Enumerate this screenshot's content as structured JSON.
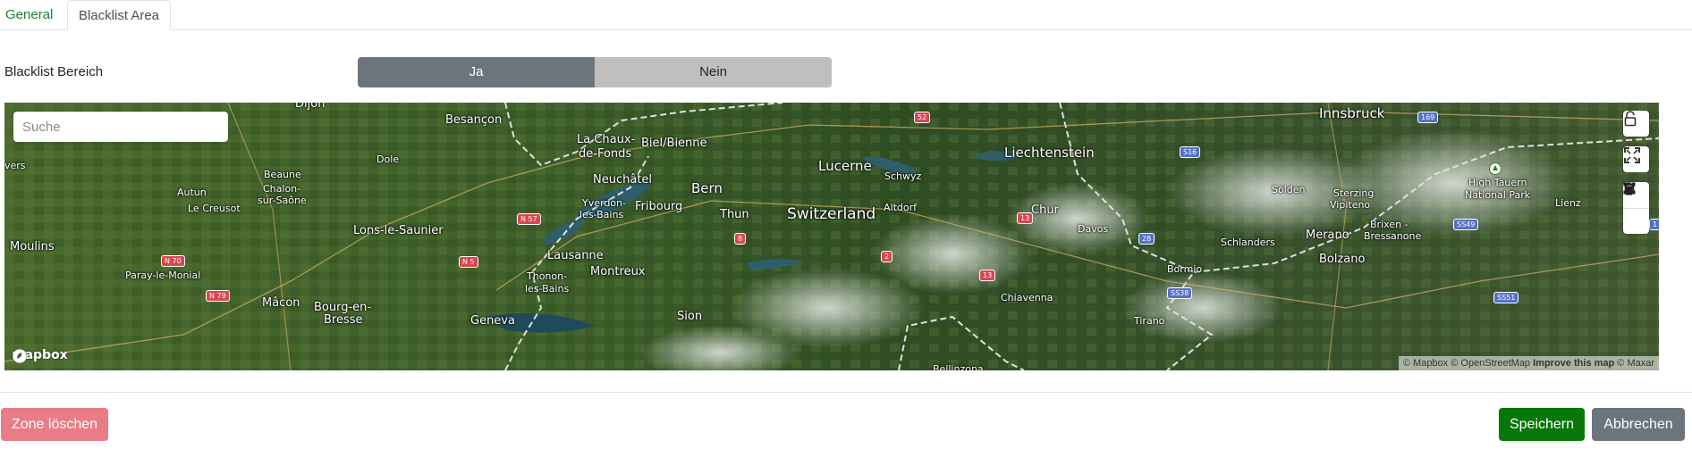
{
  "tabs": [
    {
      "label": "General",
      "active": false
    },
    {
      "label": "Blacklist Area",
      "active": true
    }
  ],
  "blacklist": {
    "label": "Blacklist Bereich",
    "options": [
      "Ja",
      "Nein"
    ],
    "selected": "Ja"
  },
  "map": {
    "search_placeholder": "Suche",
    "logo_text": "mapbox",
    "attribution": {
      "mapbox": "© Mapbox",
      "osm": "© OpenStreetMap",
      "improve": "Improve this map",
      "maxar": "© Maxar"
    },
    "labels": [
      "Dijon",
      "Besançon",
      "La Chaux-",
      "de-Fonds",
      "Biel/Bienne",
      "Lucerne",
      "Schwyz",
      "Liechtenstein",
      "Innsbruck",
      "Beaune",
      "Dole",
      "Neuchâtel",
      "Bern",
      "Altdorf",
      "Chur",
      "Davos",
      "Sölden",
      "Sterzing",
      "Vipiteno",
      "High Tauern",
      "National Park",
      "Autun",
      "Chalon-",
      "sur-Saône",
      "Le Creusot",
      "Lons-le-Saunier",
      "Yverdon-",
      "les-Bains",
      "Fribourg",
      "Thun",
      "Switzerland",
      "Schlanders",
      "Merano",
      "Brixen -",
      "Bressanone",
      "Lienz",
      "Moulins",
      "Paray-le-Monial",
      "Lausanne",
      "Bolzano",
      "Bormio",
      "Mâcon",
      "Bourg-en-",
      "Bresse",
      "Thonon-",
      "les-Bains",
      "Montreux",
      "Geneva",
      "Sion",
      "Chiavenna",
      "Tirano",
      "Bellinzona",
      "vers"
    ],
    "road_shields": [
      "52",
      "S16",
      "169",
      "N 57",
      "8",
      "13",
      "28",
      "2",
      "13",
      "N 70",
      "N 5",
      "N 79",
      "SS49",
      "SS38",
      "SS51",
      "1"
    ],
    "controls": [
      "lock-icon",
      "fullscreen-icon",
      "draw-polygon-icon",
      "trash-icon"
    ]
  },
  "footer": {
    "delete_label": "Zone löschen",
    "save_label": "Speichern",
    "cancel_label": "Abbrechen"
  },
  "colors": {
    "tab_link": "#1e7e34",
    "toggle_active": "#6c757d",
    "toggle_inactive": "#bfbfbf",
    "delete": "#e97c85",
    "save": "#08770a",
    "cancel": "#6c757d"
  }
}
